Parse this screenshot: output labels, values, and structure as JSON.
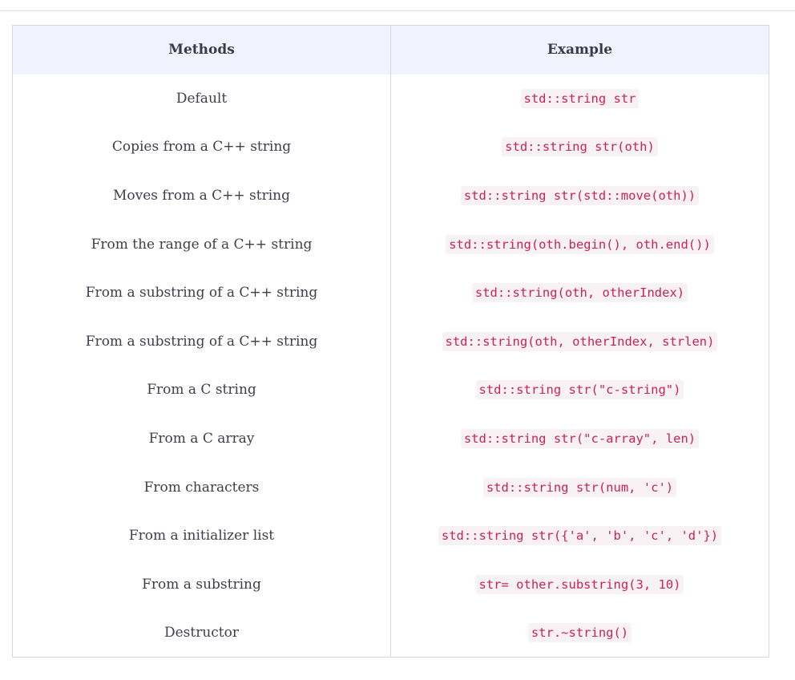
{
  "table": {
    "headers": {
      "methods": "Methods",
      "example": "Example"
    },
    "rows": [
      {
        "method": "Default",
        "example": "std::string str"
      },
      {
        "method": "Copies from a C++ string",
        "example": "std::string str(oth)"
      },
      {
        "method": "Moves from a C++ string",
        "example": "std::string str(std::move(oth))"
      },
      {
        "method": "From the range of a C++ string",
        "example": "std::string(oth.begin(), oth.end())"
      },
      {
        "method": "From a substring of a C++ string",
        "example": "std::string(oth, otherIndex)"
      },
      {
        "method": "From a substring of a C++ string",
        "example": "std::string(oth, otherIndex, strlen)"
      },
      {
        "method": "From a C string",
        "example": "std::string str(\"c-string\")"
      },
      {
        "method": "From a C array",
        "example": "std::string str(\"c-array\", len)"
      },
      {
        "method": "From characters",
        "example": "std::string str(num, 'c')"
      },
      {
        "method": "From a initializer list",
        "example": "std::string str({'a', 'b', 'c', 'd'})"
      },
      {
        "method": "From a substring",
        "example": "str= other.substring(3, 10)"
      },
      {
        "method": "Destructor",
        "example": "str.~string()"
      }
    ]
  },
  "colors": {
    "header_background": "#f2f2ff",
    "code_text": "#cc2255",
    "code_background": "#f8f2f4",
    "border": "#d7d7dc"
  }
}
